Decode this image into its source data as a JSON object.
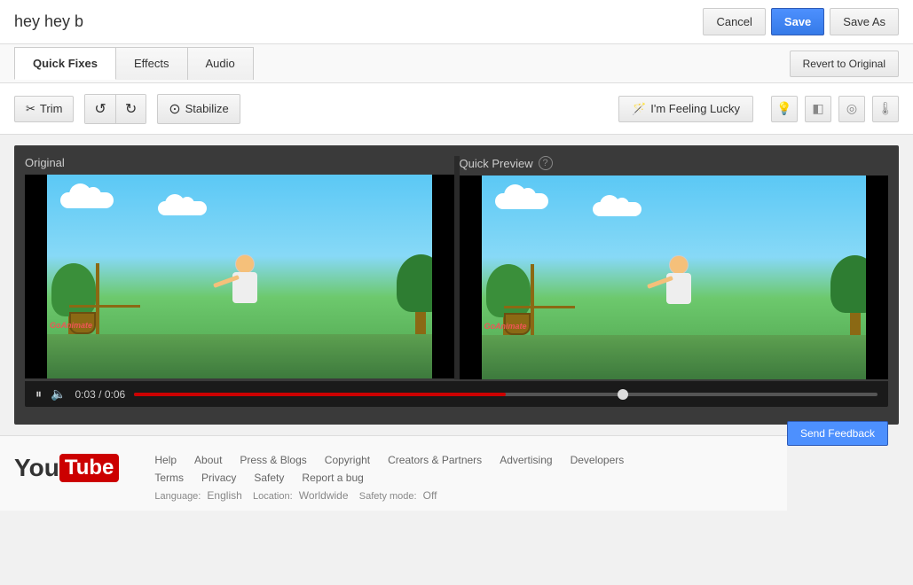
{
  "header": {
    "title": "hey hey b",
    "buttons": {
      "cancel": "Cancel",
      "save": "Save",
      "save_as": "Save As"
    }
  },
  "tabs_bar": {
    "tabs": [
      {
        "label": "Quick Fixes",
        "active": true
      },
      {
        "label": "Effects",
        "active": false
      },
      {
        "label": "Audio",
        "active": false
      }
    ],
    "revert_label": "Revert to Original"
  },
  "toolbar": {
    "trim": "Trim",
    "stabilize": "Stabilize",
    "lucky": "I'm Feeling Lucky"
  },
  "video": {
    "original_label": "Original",
    "preview_label": "Quick Preview",
    "time_current": "0:03",
    "time_total": "0:06",
    "progress_pct": 50,
    "knob_pct": 68,
    "send_feedback": "Send Feedback"
  },
  "footer": {
    "logo_you": "You",
    "logo_tube": "Tube",
    "links_row1": [
      "Help",
      "About",
      "Press & Blogs",
      "Copyright",
      "Creators & Partners",
      "Advertising",
      "Developers"
    ],
    "links_row2": [
      "Terms",
      "Privacy",
      "Safety",
      "Report a bug"
    ],
    "language_label": "Language:",
    "language_value": "English",
    "location_label": "Location:",
    "location_value": "Worldwide",
    "safety_label": "Safety mode:",
    "safety_value": "Off"
  }
}
